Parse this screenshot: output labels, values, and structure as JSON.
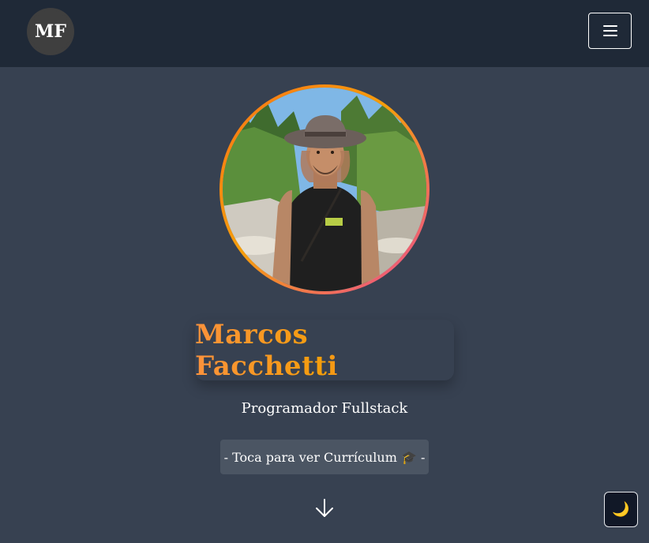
{
  "header": {
    "logo_text": "MF",
    "menu_icon": "hamburger-menu-icon"
  },
  "hero": {
    "name": "Marcos Facchetti",
    "title": "Programador Fullstack",
    "cv_button_label": "- Toca para ver Currículum 🎓 -",
    "scroll_icon": "arrow-down-icon"
  },
  "theme_toggle": {
    "icon": "🌙"
  },
  "colors": {
    "header_bg": "#1f2937",
    "page_bg": "#374151",
    "gradient_start": "#f97316",
    "gradient_mid": "#f59e0b",
    "gradient_end": "#ec4899"
  }
}
